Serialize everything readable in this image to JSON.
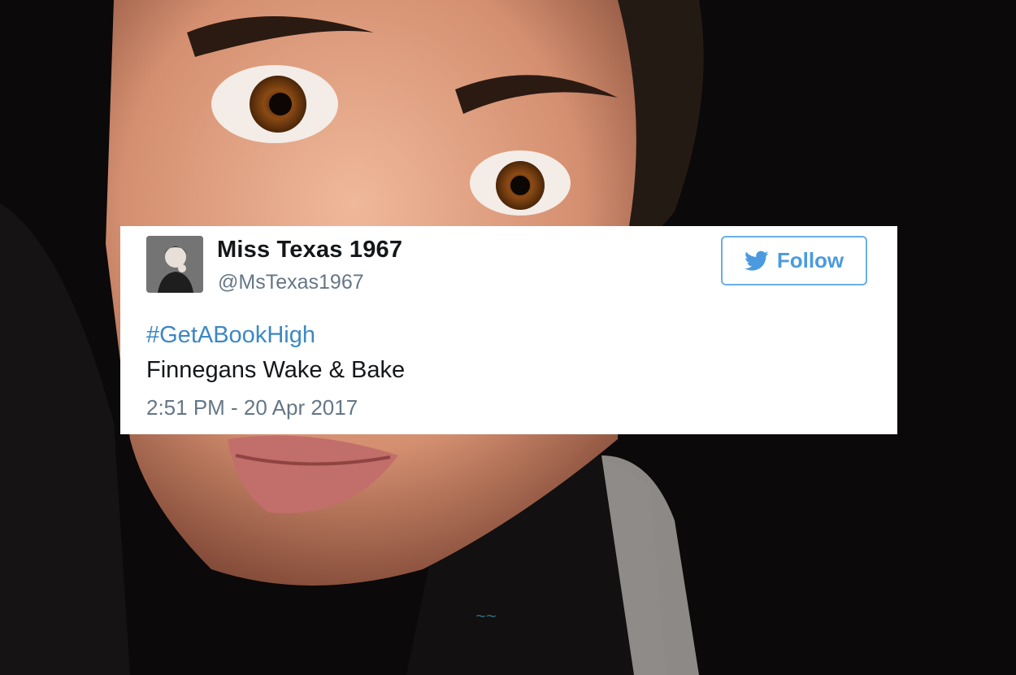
{
  "tweet": {
    "display_name": "Miss Texas 1967",
    "handle": "@MsTexas1967",
    "follow_label": "Follow",
    "hashtag": "#GetABookHigh",
    "text": "Finnegans Wake & Bake",
    "timestamp": "2:51 PM - 20 Apr 2017"
  },
  "colors": {
    "accent": "#4b9ae0",
    "hashtag": "#3b88c3",
    "text": "#14171a",
    "muted": "#657786"
  },
  "icons": {
    "follow_icon": "twitter-bird-icon",
    "avatar": "profile-avatar"
  }
}
